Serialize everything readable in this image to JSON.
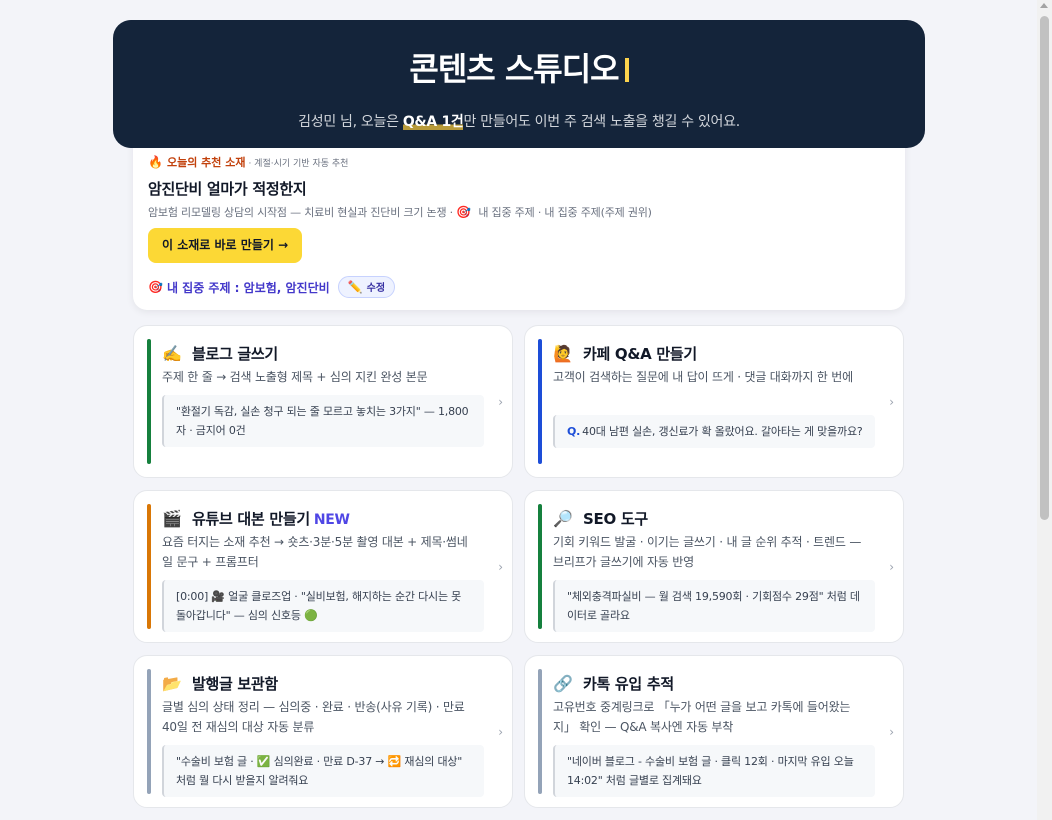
{
  "hero": {
    "title": "콘텐츠 스튜디오",
    "subtitle_before": "김성민 님, 오늘은 ",
    "subtitle_highlight": "Q&A 1건",
    "subtitle_after": "만 만들어도 이번 주 검색 노출을 챙길 수 있어요."
  },
  "recommend": {
    "kicker": "오늘의 추천 소재",
    "kicker_sub": "· 계절·시기 기반 자동 추천",
    "title": "암진단비 얼마가 적정한지",
    "description": "암보험 리모델링 상담의 시작점 — 치료비 현실과 진단비 크기 논쟁 · ",
    "description_tail": " 내 집중 주제 · 내 집중 주제(주제 권위)",
    "cta_label": "이 소재로 바로 만들기 →",
    "focus_label": "내 집중 주제 : 암보험, 암진단비",
    "edit_label": "수정"
  },
  "cards": [
    {
      "icon": "✍️",
      "title": "블로그 글쓰기",
      "badge": "",
      "bar_color": "#15803d",
      "description": "주제 한 줄 → 검색 노출형 제목 + 심의 지킨 완성 본문",
      "q": "",
      "example": "\"환절기 독감, 실손 청구 되는 줄 모르고 놓치는 3가지\" — 1,800자 · 금지어 0건"
    },
    {
      "icon": "🙋",
      "title": "카페 Q&A 만들기",
      "badge": "",
      "bar_color": "#1d4ed8",
      "description": "고객이 검색하는 질문에 내 답이 뜨게 · 댓글 대화까지 한 번에",
      "q": "Q.",
      "example": "40대 남편 실손, 갱신료가 확 올랐어요. 갈아타는 게 맞을까요?"
    },
    {
      "icon": "🎬",
      "title": "유튜브 대본 만들기",
      "badge": "NEW",
      "bar_color": "#d97706",
      "description": "요즘 터지는 소재 추천 → 숏츠·3분·5분 촬영 대본 + 제목·썸네일 문구 + 프롬프터",
      "q": "",
      "example": "[0:00] 🎥 얼굴 클로즈업 · \"실비보험, 해지하는 순간 다시는 못 돌아갑니다\" — 심의 신호등 🟢"
    },
    {
      "icon": "🔎",
      "title": "SEO 도구",
      "badge": "",
      "bar_color": "#15803d",
      "description": "기회 키워드 발굴 · 이기는 글쓰기 · 내 글 순위 추적 · 트렌드 — 브리프가 글쓰기에 자동 반영",
      "q": "",
      "example": "\"체외충격파실비 — 월 검색 19,590회 · 기회점수 29점\" 처럼 데이터로 골라요"
    },
    {
      "icon": "📂",
      "title": "발행글 보관함",
      "badge": "",
      "bar_color": "#94a3b8",
      "description": "글별 심의 상태 정리 — 심의중 · 완료 · 반송(사유 기록) · 만료 40일 전 재심의 대상 자동 분류",
      "q": "",
      "example": "\"수술비 보험 글 · ✅ 심의완료 · 만료 D-37 → 🔁 재심의 대상\" 처럼 뭘 다시 받을지 알려줘요"
    },
    {
      "icon": "🔗",
      "title": "카톡 유입 추적",
      "badge": "",
      "bar_color": "#94a3b8",
      "description": "고유번호 중계링크로 「누가 어떤 글을 보고 카톡에 들어왔는지」 확인 — Q&A 복사엔 자동 부착",
      "q": "",
      "example": "\"네이버 블로그 - 수술비 보험 글 · 클릭 12회 · 마지막 유입 오늘 14:02\" 처럼 글별로 집계돼요"
    }
  ],
  "icons": {
    "fire": "fire-icon",
    "target": "target-icon",
    "pencil": "pencil-icon"
  }
}
